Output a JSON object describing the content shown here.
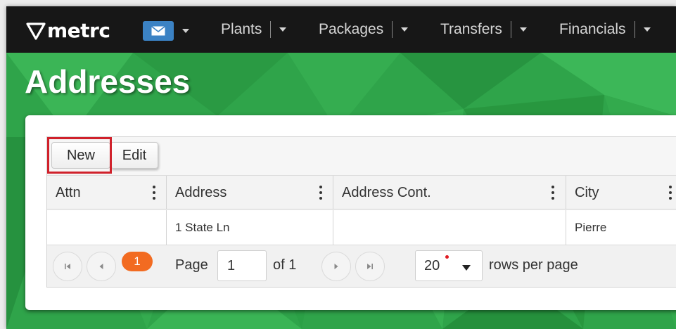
{
  "app": {
    "logo_text": "metrc",
    "nav": [
      {
        "label": "Plants"
      },
      {
        "label": "Packages"
      },
      {
        "label": "Transfers"
      },
      {
        "label": "Financials"
      }
    ]
  },
  "page": {
    "title": "Addresses"
  },
  "toolbar": {
    "new_label": "New",
    "edit_label": "Edit"
  },
  "table": {
    "columns": [
      {
        "label": "Attn"
      },
      {
        "label": "Address"
      },
      {
        "label": "Address Cont."
      },
      {
        "label": "City"
      }
    ],
    "rows": [
      {
        "attn": "",
        "address": "1 State Ln",
        "address_cont": "",
        "city": "Pierre"
      }
    ]
  },
  "pager": {
    "current_page": "1",
    "page_label": "Page",
    "page_value": "1",
    "of_label": "of 1",
    "rows_per_page_value": "20",
    "rows_per_page_label": "rows per page"
  },
  "colors": {
    "navbar": "#171717",
    "mail_button": "#3b82c4",
    "background_green": "#2fa44a",
    "highlight_red": "#d0212b",
    "current_page_orange": "#f26b21"
  },
  "icons": {
    "mail": "mail-icon",
    "first": "first-page-icon",
    "prev": "prev-page-icon",
    "next": "next-page-icon",
    "last": "last-page-icon"
  }
}
